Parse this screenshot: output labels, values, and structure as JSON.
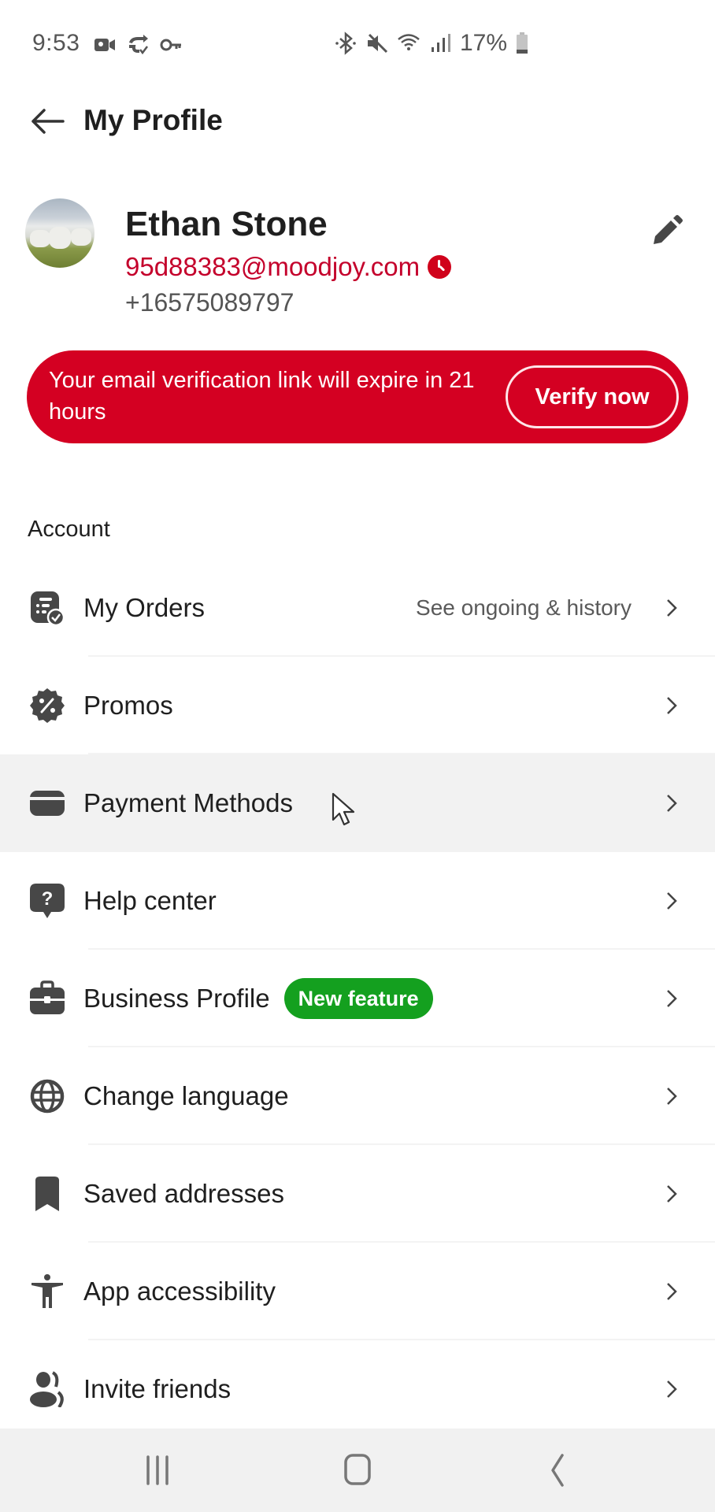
{
  "status_bar": {
    "time": "9:53",
    "left_icons": [
      "video-call-icon",
      "sync-check-icon",
      "key-icon"
    ],
    "right_icons": [
      "bluetooth-icon",
      "mute-icon",
      "wifi-icon",
      "signal-icon"
    ],
    "battery_percent": "17%"
  },
  "header": {
    "back_icon": "arrow-left-icon",
    "title": "My Profile"
  },
  "profile": {
    "name": "Ethan Stone",
    "email": "95d88383@moodjoy.com",
    "email_status_icon": "clock-icon",
    "phone": "+16575089797",
    "edit_icon": "pencil-icon"
  },
  "verify_banner": {
    "message": "Your email verification link will expire in 21 hours",
    "button_label": "Verify now",
    "color": "#d40022"
  },
  "section": {
    "title": "Account"
  },
  "menu": {
    "items": [
      {
        "icon": "orders-icon",
        "label": "My Orders",
        "subtitle": "See ongoing & history"
      },
      {
        "icon": "promo-icon",
        "label": "Promos"
      },
      {
        "icon": "payment-card-icon",
        "label": "Payment Methods",
        "highlighted": true
      },
      {
        "icon": "help-icon",
        "label": "Help center"
      },
      {
        "icon": "briefcase-icon",
        "label": "Business Profile",
        "badge": "New feature"
      },
      {
        "icon": "globe-icon",
        "label": "Change language"
      },
      {
        "icon": "bookmark-icon",
        "label": "Saved addresses"
      },
      {
        "icon": "accessibility-icon",
        "label": "App accessibility"
      },
      {
        "icon": "people-icon",
        "label": "Invite friends"
      }
    ]
  },
  "colors": {
    "accent_red": "#d40022",
    "email_red": "#c4002b",
    "badge_green": "#14a01f",
    "icon_gray": "#474747"
  },
  "nav_bar": {
    "buttons": [
      "recent-apps",
      "home",
      "back"
    ]
  }
}
